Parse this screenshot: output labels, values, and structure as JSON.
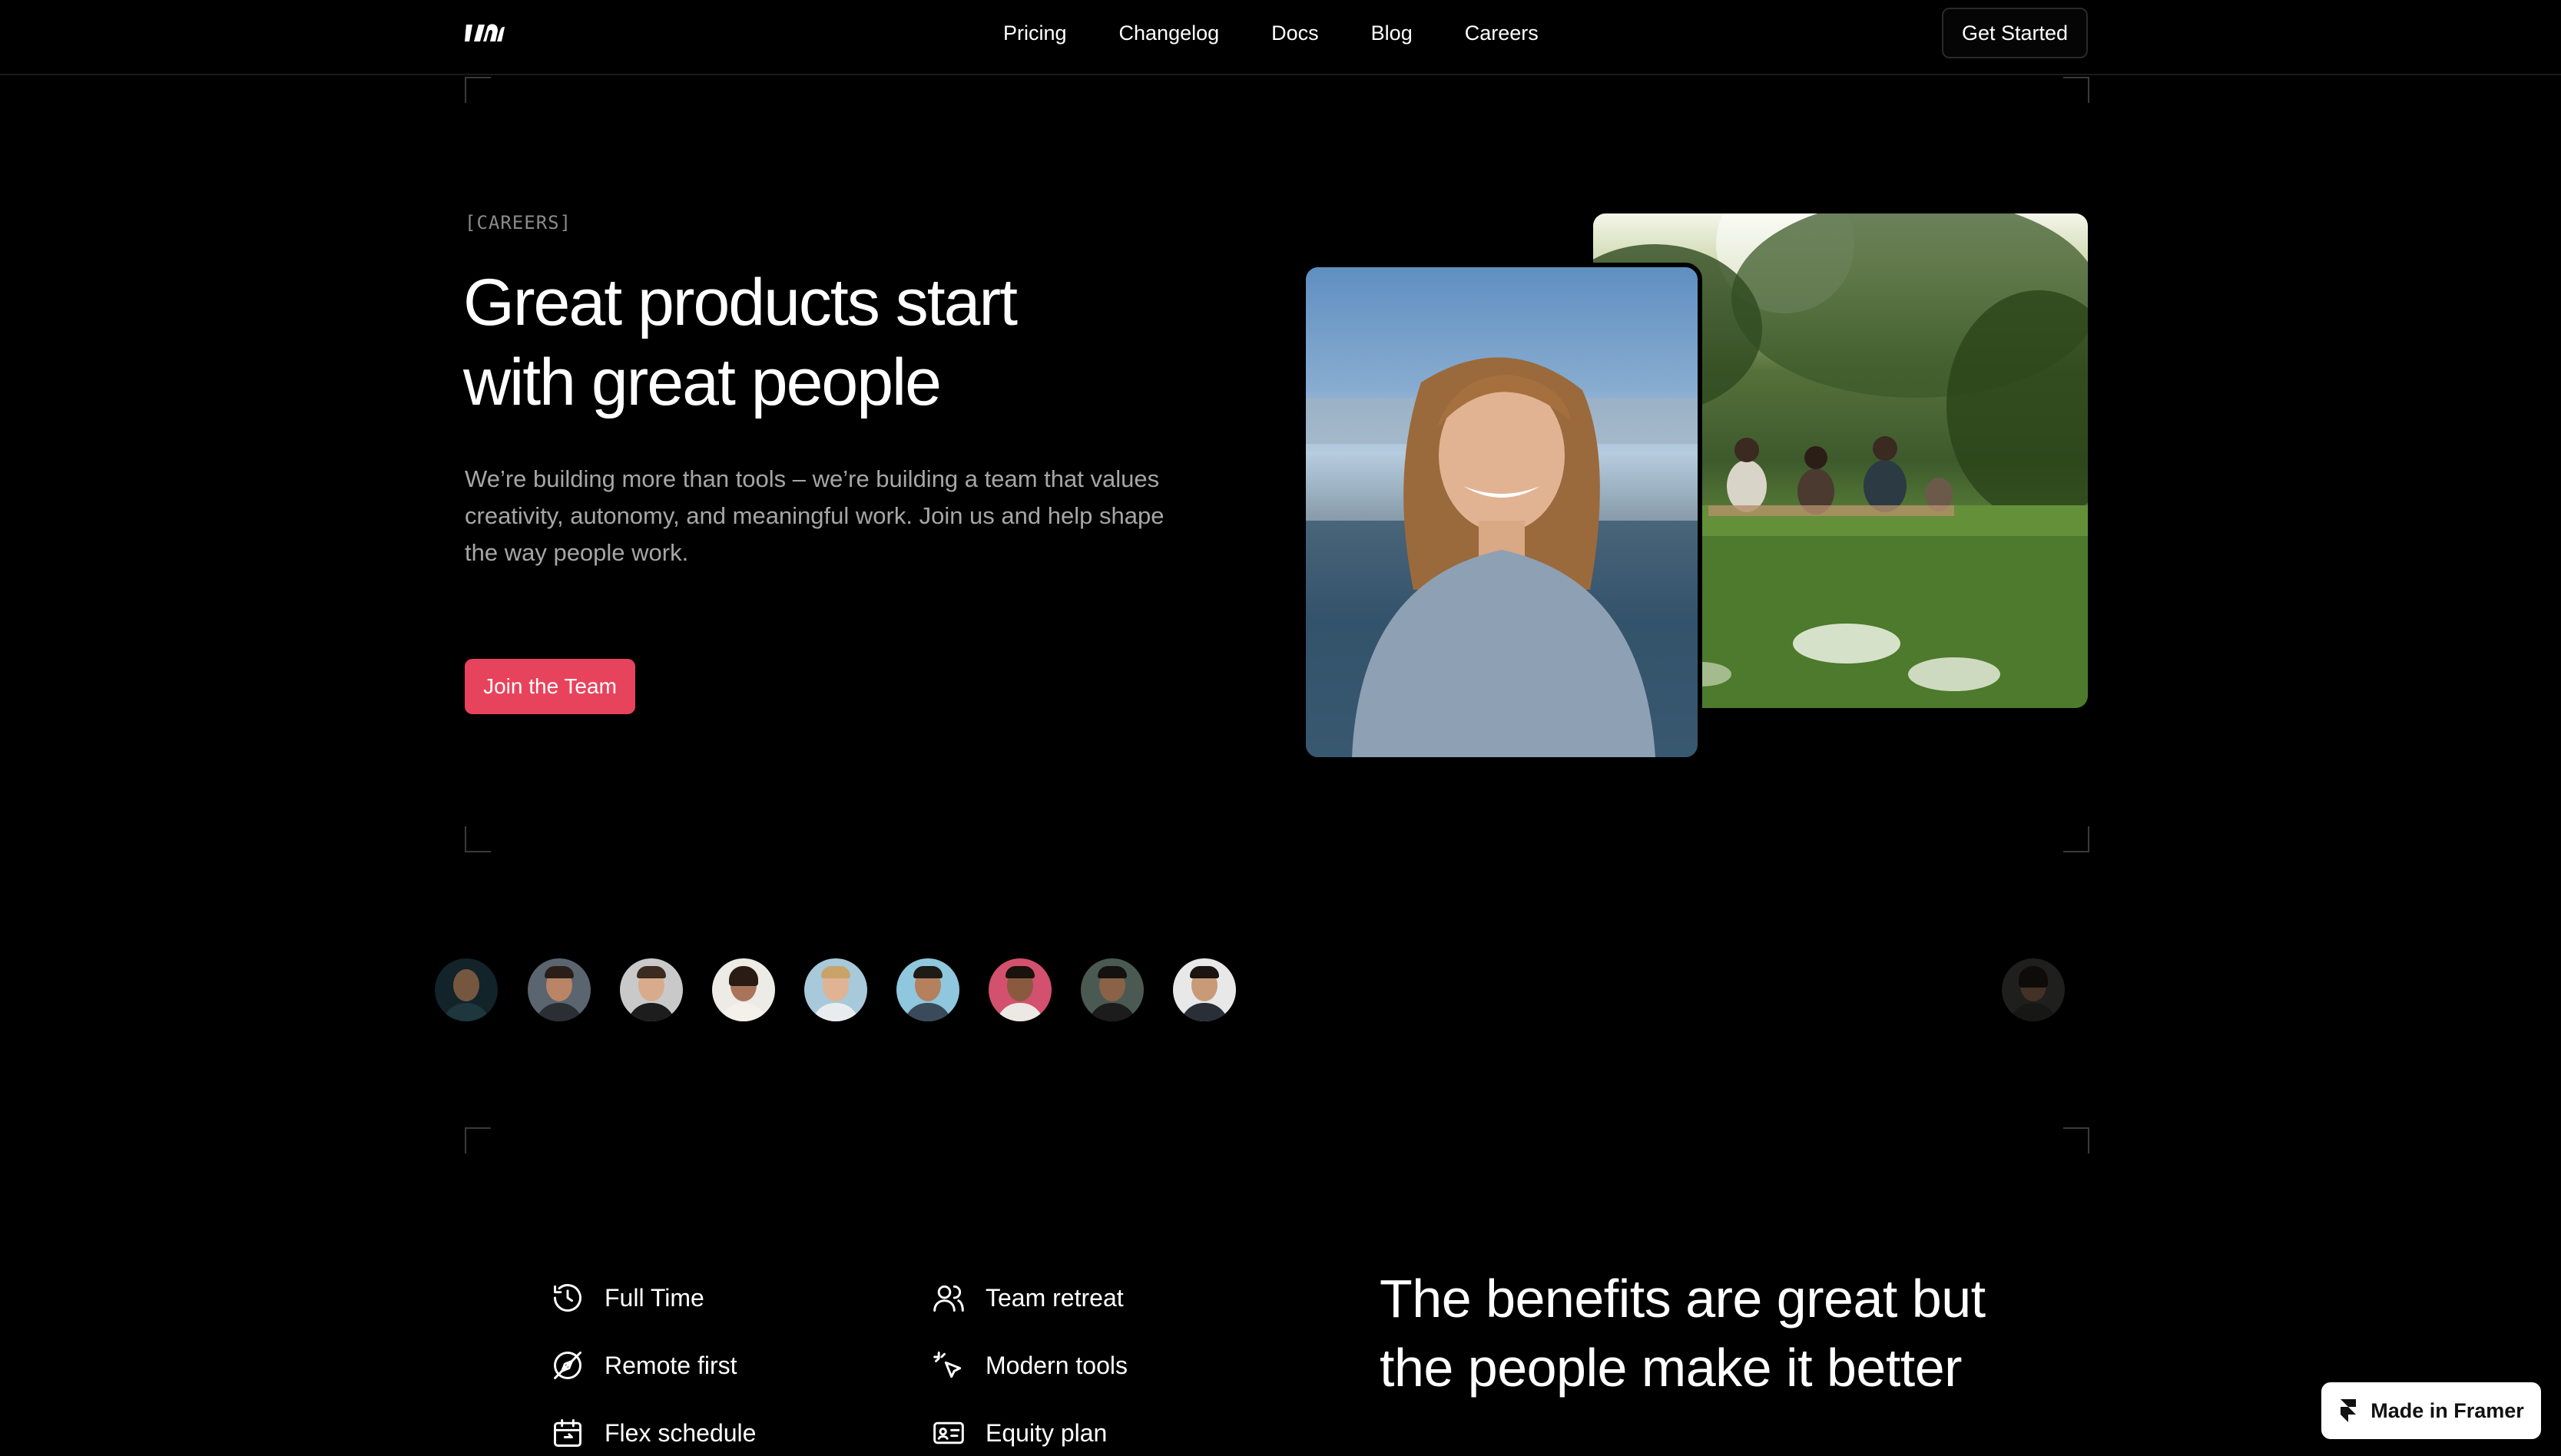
{
  "nav": {
    "logo_icon": "brand-logo-icon",
    "links": [
      "Pricing",
      "Changelog",
      "Docs",
      "Blog",
      "Careers"
    ],
    "cta": "Get Started"
  },
  "hero": {
    "eyebrow": "[CAREERS]",
    "title_line1": "Great products start",
    "title_line2": "with great people",
    "subtitle": "We’re building more than tools – we’re building a team that values creativity, autonomy, and meaningful work. Join us and help shape the way people work.",
    "cta": "Join the Team",
    "cta_color": "#e8435c"
  },
  "photos": {
    "front_alt": "smiling-woman-portrait-photo",
    "back_alt": "team-picnic-in-park-photo"
  },
  "team_avatars": [
    {
      "name": "avatar-1"
    },
    {
      "name": "avatar-2"
    },
    {
      "name": "avatar-3"
    },
    {
      "name": "avatar-4"
    },
    {
      "name": "avatar-5"
    },
    {
      "name": "avatar-6"
    },
    {
      "name": "avatar-7"
    },
    {
      "name": "avatar-8"
    },
    {
      "name": "avatar-9"
    },
    {
      "name": "avatar-10"
    }
  ],
  "benefits": {
    "items": [
      {
        "label": "Full Time",
        "icon": "clock-history-icon"
      },
      {
        "label": "Team retreat",
        "icon": "users-icon"
      },
      {
        "label": "Remote first",
        "icon": "compass-off-icon"
      },
      {
        "label": "Modern tools",
        "icon": "pointer-click-icon"
      },
      {
        "label": "Flex schedule",
        "icon": "calendar-icon"
      },
      {
        "label": "Equity plan",
        "icon": "id-card-icon"
      }
    ],
    "title_line1": "The benefits are great but",
    "title_line2": "the people make it better"
  },
  "badge": {
    "label": "Made in Framer",
    "icon": "framer-logo-icon"
  }
}
